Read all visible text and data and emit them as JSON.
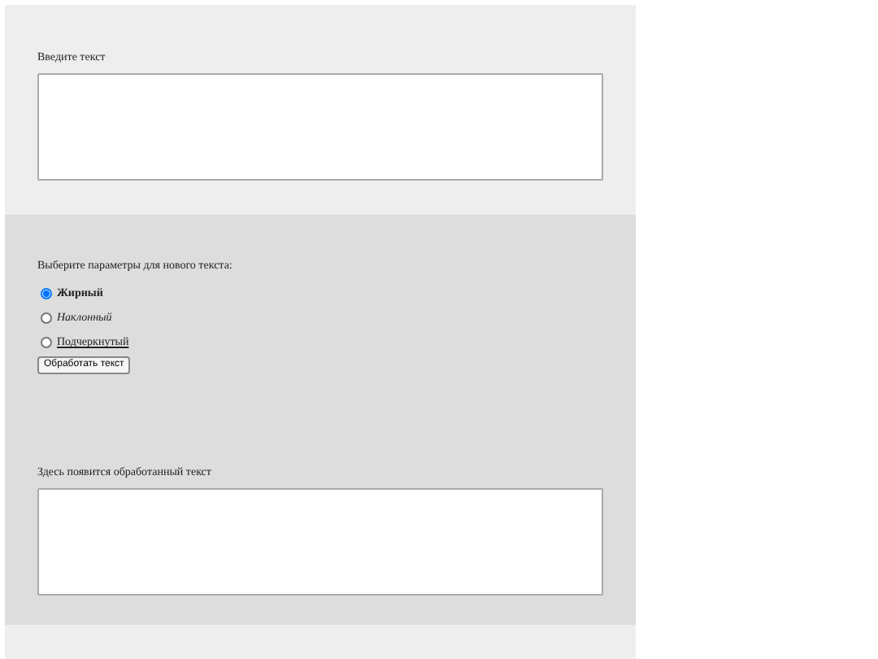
{
  "input_section": {
    "label": "Введите текст"
  },
  "options_section": {
    "prompt": "Выберите параметры для нового текста:",
    "options": [
      {
        "label": "Жирный",
        "kind": "bold",
        "selected": true
      },
      {
        "label": "Наклонный",
        "kind": "italic",
        "selected": false
      },
      {
        "label": "Подчеркнутый",
        "kind": "underline",
        "selected": false
      }
    ],
    "button": "Обработать текст",
    "output_label": "Здесь появится обработанный текст"
  }
}
